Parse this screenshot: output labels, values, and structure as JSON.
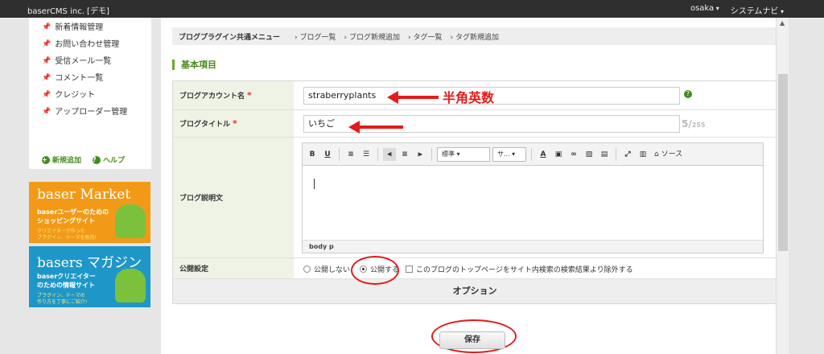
{
  "topbar": {
    "site": "baserCMS inc. [デモ]",
    "user": "osaka",
    "sysnav": "システムナビ"
  },
  "sidebar": {
    "items": [
      {
        "label": "新着情報管理"
      },
      {
        "label": "お問い合わせ管理"
      },
      {
        "label": "受信メール一覧"
      },
      {
        "label": "コメント一覧"
      },
      {
        "label": "クレジット"
      },
      {
        "label": "アップローダー管理"
      }
    ],
    "add_label": "新規追加",
    "help_label": "ヘルプ"
  },
  "banners": {
    "market": {
      "title": "baser Market",
      "line1": "baserユーザーのための",
      "line2": "ショッピングサイト",
      "small1": "クリエイターが作った",
      "small2": "プラグイン、テーマを販売!"
    },
    "magazine": {
      "title": "basers マガジン",
      "line1": "baserクリエイター",
      "line2": "のための情報サイト",
      "small1": "プラグイン、テーマの",
      "small2": "作り方を丁寧にご紹介!"
    }
  },
  "subnav": {
    "head": "ブログプラグイン共通メニュー",
    "links": [
      "ブログ一覧",
      "ブログ新規追加",
      "タグ一覧",
      "タグ新規追加"
    ]
  },
  "section_title": "基本項目",
  "form": {
    "account_label": "ブログアカウント名",
    "account_value": "straberryplants",
    "title_label": "ブログタイトル",
    "title_value": "いちご",
    "counter_value": "5/",
    "counter_max": "255",
    "desc_label": "ブログ説明文",
    "editor": {
      "format": "標準",
      "font": "サ...",
      "source": "ソース",
      "path": "body  p"
    },
    "publish_label": "公開設定",
    "publish_options": [
      "公開しない",
      "公開する"
    ],
    "publish_selected": "公開する",
    "exclude_label": "このブログのトップページをサイト内検索の検索結果より除外する",
    "options_label": "オプション"
  },
  "annotation": "半角英数",
  "save_label": "保存",
  "colors": {
    "accent": "#6ea526",
    "annotation": "#e31b1b",
    "topbar": "#2f2f2f"
  }
}
